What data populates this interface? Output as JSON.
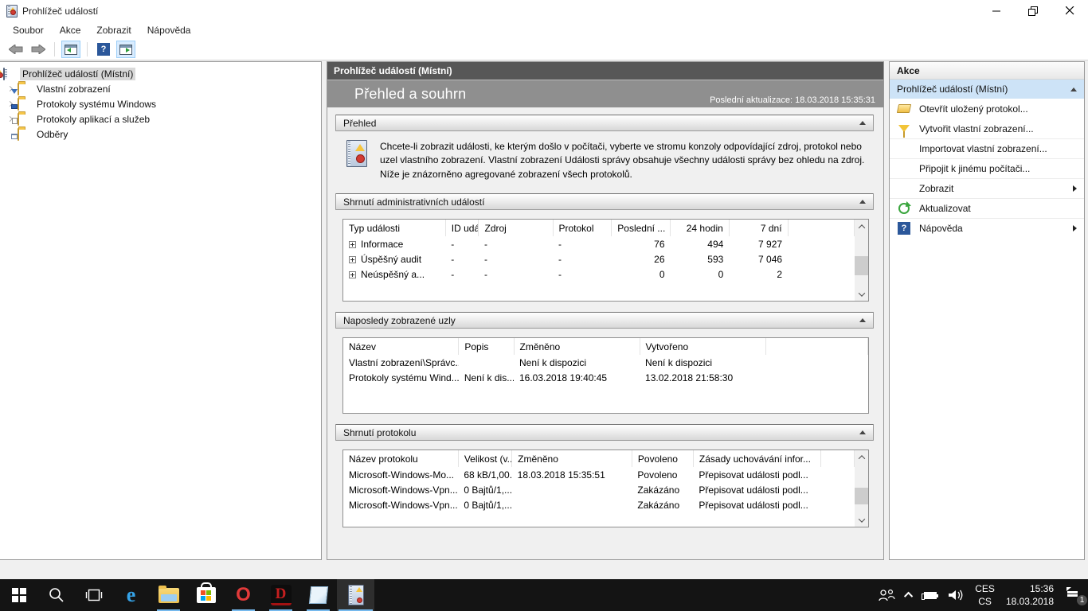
{
  "window": {
    "title": "Prohlížeč událostí",
    "menu": [
      "Soubor",
      "Akce",
      "Zobrazit",
      "Nápověda"
    ]
  },
  "sidebar": {
    "items": [
      {
        "label": "Prohlížeč událostí (Místní)",
        "selected": true
      },
      {
        "label": "Vlastní zobrazení"
      },
      {
        "label": "Protokoly systému Windows"
      },
      {
        "label": "Protokoly aplikací a služeb"
      },
      {
        "label": "Odběry"
      }
    ]
  },
  "center": {
    "console_root": "Prohlížeč událostí (Místní)",
    "banner_title": "Přehled a souhrn",
    "last_update": "Poslední aktualizace: 18.03.2018 15:35:31",
    "sections": {
      "overview": {
        "title": "Přehled",
        "text": "Chcete-li zobrazit události, ke kterým došlo v počítači, vyberte ve stromu konzoly odpovídající zdroj, protokol nebo uzel vlastního zobrazení. Vlastní zobrazení Události správy obsahuje všechny události správy bez ohledu na zdroj. Níže je znázorněno agregované zobrazení všech protokolů."
      },
      "admin": {
        "title": "Shrnutí administrativních událostí",
        "table": {
          "columns": [
            "Typ události",
            "ID událo...",
            "Zdroj",
            "Protokol",
            "Poslední ...",
            "24 hodin",
            "7 dní",
            ""
          ],
          "rows": [
            {
              "expander": true,
              "cells": [
                "Informace",
                "-",
                "-",
                "-",
                "76",
                "494",
                "7 927",
                ""
              ]
            },
            {
              "expander": true,
              "cells": [
                "Úspěšný audit",
                "-",
                "-",
                "-",
                "26",
                "593",
                "7 046",
                ""
              ]
            },
            {
              "expander": true,
              "cells": [
                "Neúspěšný a...",
                "-",
                "-",
                "-",
                "0",
                "0",
                "2",
                ""
              ]
            }
          ]
        }
      },
      "nodes": {
        "title": "Naposledy zobrazené uzly",
        "table": {
          "columns": [
            "Název",
            "Popis",
            "Změněno",
            "Vytvořeno",
            ""
          ],
          "rows": [
            {
              "cells": [
                "Vlastní zobrazení\\Správc...",
                "",
                "Není k dispozici",
                "Není k dispozici",
                ""
              ]
            },
            {
              "cells": [
                "Protokoly systému Wind...",
                "Není k dis...",
                "16.03.2018 19:40:45",
                "13.02.2018 21:58:30",
                ""
              ]
            }
          ]
        }
      },
      "logs": {
        "title": "Shrnutí protokolu",
        "table": {
          "columns": [
            "Název protokolu",
            "Velikost (v...",
            "Změněno",
            "Povoleno",
            "Zásady uchovávání infor...",
            ""
          ],
          "rows": [
            {
              "cells": [
                "Microsoft-Windows-Mo...",
                "68 kB/1,00...",
                "18.03.2018 15:35:51",
                "Povoleno",
                "Přepisovat události podl...",
                ""
              ]
            },
            {
              "cells": [
                "Microsoft-Windows-Vpn...",
                "0 Bajtů/1,...",
                "",
                "Zakázáno",
                "Přepisovat události podl...",
                ""
              ]
            },
            {
              "cells": [
                "Microsoft-Windows-Vpn...",
                "0 Bajtů/1,...",
                "",
                "Zakázáno",
                "Přepisovat události podl...",
                ""
              ]
            }
          ]
        }
      }
    }
  },
  "actions": {
    "header": "Akce",
    "group_title": "Prohlížeč událostí (Místní)",
    "items": [
      {
        "label": "Otevřít uložený protokol...",
        "icon": "open-folder-icon"
      },
      {
        "label": "Vytvořit vlastní zobrazení...",
        "icon": "filter-funnel-icon"
      },
      {
        "label": "Importovat vlastní zobrazení..."
      },
      {
        "label": "Připojit k jinému počítači..."
      },
      {
        "label": "Zobrazit",
        "submenu": true
      },
      {
        "label": "Aktualizovat",
        "icon": "refresh-icon"
      },
      {
        "label": "Nápověda",
        "icon": "help-icon",
        "submenu": true
      }
    ]
  },
  "taskbar": {
    "tray": {
      "lang_line1": "CES",
      "lang_line2": "CS",
      "time": "15:36",
      "date": "18.03.2018",
      "badge": "1"
    }
  }
}
